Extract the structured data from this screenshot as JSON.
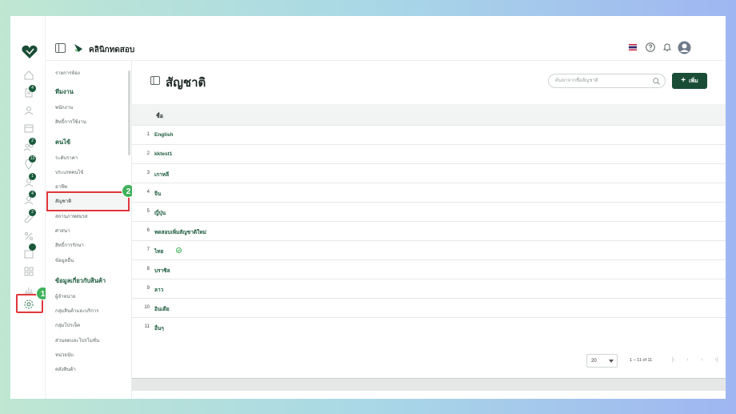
{
  "app": {
    "title": "คลินิกทดสอบ",
    "colors": {
      "brand": "#1a4d36",
      "accent": "#3fb15a",
      "highlight": "#e0363b"
    }
  },
  "rail": {
    "badges": [
      "4",
      "2",
      "13",
      "1",
      "4",
      "2"
    ],
    "icons": [
      "home-icon",
      "clipboard-icon",
      "person-icon",
      "calendar-icon",
      "users-icon",
      "location-icon",
      "user-queue-icon",
      "user-doctor-icon",
      "pill-icon",
      "percent-icon",
      "inbox-icon",
      "grid-icon",
      "chart-icon",
      "gear-icon"
    ]
  },
  "steps": {
    "one": "1",
    "two": "2"
  },
  "submenu": {
    "top_item": "รายการห้อง",
    "team_heading": "ทีมงาน",
    "team_items": [
      "พนักงาน",
      "สิทธิ์การใช้งาน"
    ],
    "customer_heading": "คนไข้",
    "customer_items": [
      "ระดับราคา",
      "ประเภทคนไข้",
      "อาชีพ",
      "สัญชาติ",
      "สถานภาพสมรส",
      "ศาสนา",
      "สิทธิ์การรักษา",
      "ข้อมูลอื่น"
    ],
    "product_heading": "ข้อมูลเกี่ยวกับสินค้า",
    "product_items": [
      "ผู้จำหน่าย",
      "กลุ่มสินค้าและบริการ",
      "กลุ่มโปรเจ็ค",
      "ส่วนลดและโปรโมชั่น",
      "หน่วยนับ",
      "คลังสินค้า"
    ]
  },
  "main": {
    "title": "สัญชาติ",
    "search_placeholder": "ค้นหาจากชื่อสัญชาติ",
    "add_label": "เพิ่ม",
    "column_name": "ชื่อ",
    "rows": [
      {
        "no": "1",
        "name": "English"
      },
      {
        "no": "2",
        "name": "kktest1"
      },
      {
        "no": "3",
        "name": "เกาหลี"
      },
      {
        "no": "4",
        "name": "จีน"
      },
      {
        "no": "5",
        "name": "ญี่ปุ่น"
      },
      {
        "no": "6",
        "name": "ทดสอบเพิ่มสัญชาติใหม่"
      },
      {
        "no": "7",
        "name": "ไทย"
      },
      {
        "no": "8",
        "name": "บราซิล"
      },
      {
        "no": "9",
        "name": "ลาว"
      },
      {
        "no": "10",
        "name": "อินเดีย"
      },
      {
        "no": "11",
        "name": "อื่นๆ"
      }
    ],
    "pagination": {
      "page_size": "20",
      "range": "1 – 11 of 11"
    }
  }
}
